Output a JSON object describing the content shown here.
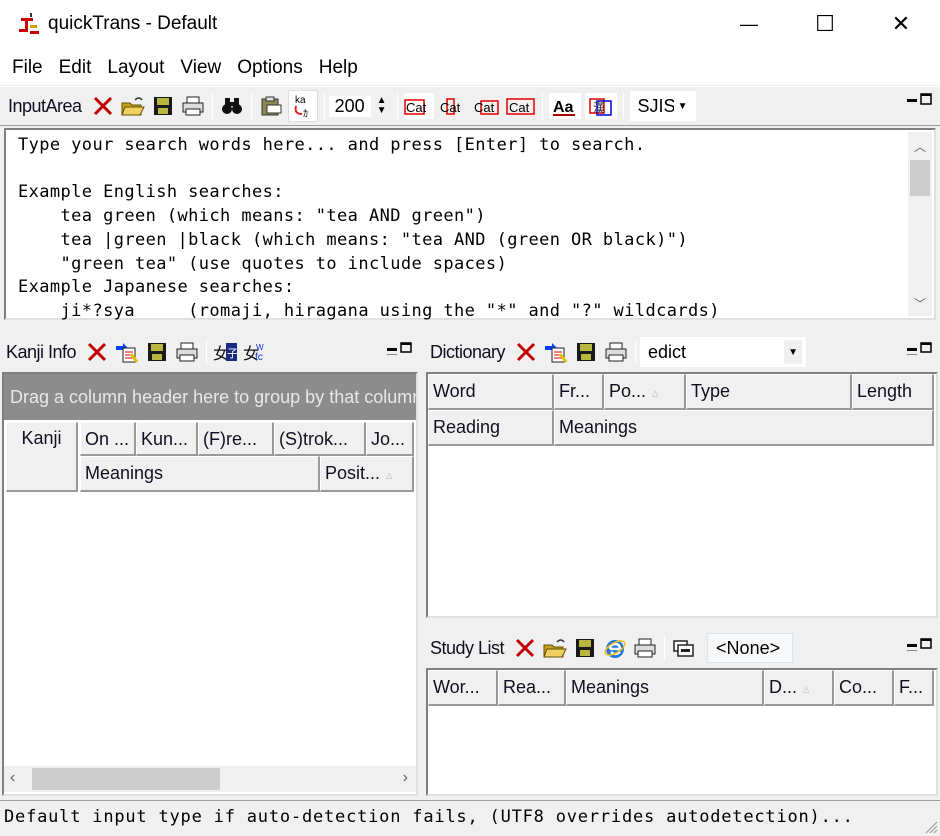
{
  "window": {
    "title": "quickTrans - Default",
    "controls": {
      "minimize": "—",
      "maximize": "☐",
      "close": "✕"
    }
  },
  "menu": [
    "File",
    "Edit",
    "Layout",
    "View",
    "Options",
    "Help"
  ],
  "input_area": {
    "title": "InputArea",
    "font_size": "200",
    "encoding": "SJIS",
    "text_lines": [
      "Type your search words here... and press [Enter] to search.",
      "",
      "Example English searches:",
      "    tea green (which means: \"tea AND green\")",
      "    tea |green |black (which means: \"tea AND (green OR black)\")",
      "    \"green tea\" (use quotes to include spaces)",
      "Example Japanese searches:",
      "    ji*?sya     (romaji, hiragana using the \"*\" and \"?\" wildcards)"
    ],
    "icons": [
      "clear-icon",
      "open-folder-icon",
      "save-icon",
      "print-icon",
      "binoculars-icon",
      "clipboard-icon",
      "kana-convert-icon",
      "cat-style-1-icon",
      "cat-style-2-icon",
      "cat-style-3-icon",
      "cat-style-4-icon",
      "font-icon",
      "kanji-box-icon"
    ]
  },
  "kanji_info": {
    "title": "Kanji Info",
    "group_hint": "Drag a column header here to group by that column",
    "columns_row1": [
      "Kanji",
      "On ...",
      "Kun...",
      "(F)re...",
      "(S)trok...",
      "Jo..."
    ],
    "columns_row2": [
      "Meanings",
      "Posit..."
    ]
  },
  "dictionary": {
    "title": "Dictionary",
    "selected_dictionary": "edict",
    "columns_row1": [
      "Word",
      "Fr...",
      "Po...",
      "Type",
      "Length"
    ],
    "columns_row2": [
      "Reading",
      "Meanings"
    ]
  },
  "study_list": {
    "title": "Study List",
    "selected_list": "<None>",
    "columns": [
      "Wor...",
      "Rea...",
      "Meanings",
      "D...",
      "Co...",
      "F..."
    ]
  },
  "status": {
    "text": "Default input type if auto-detection fails, (UTF8 overrides autodetection)..."
  }
}
